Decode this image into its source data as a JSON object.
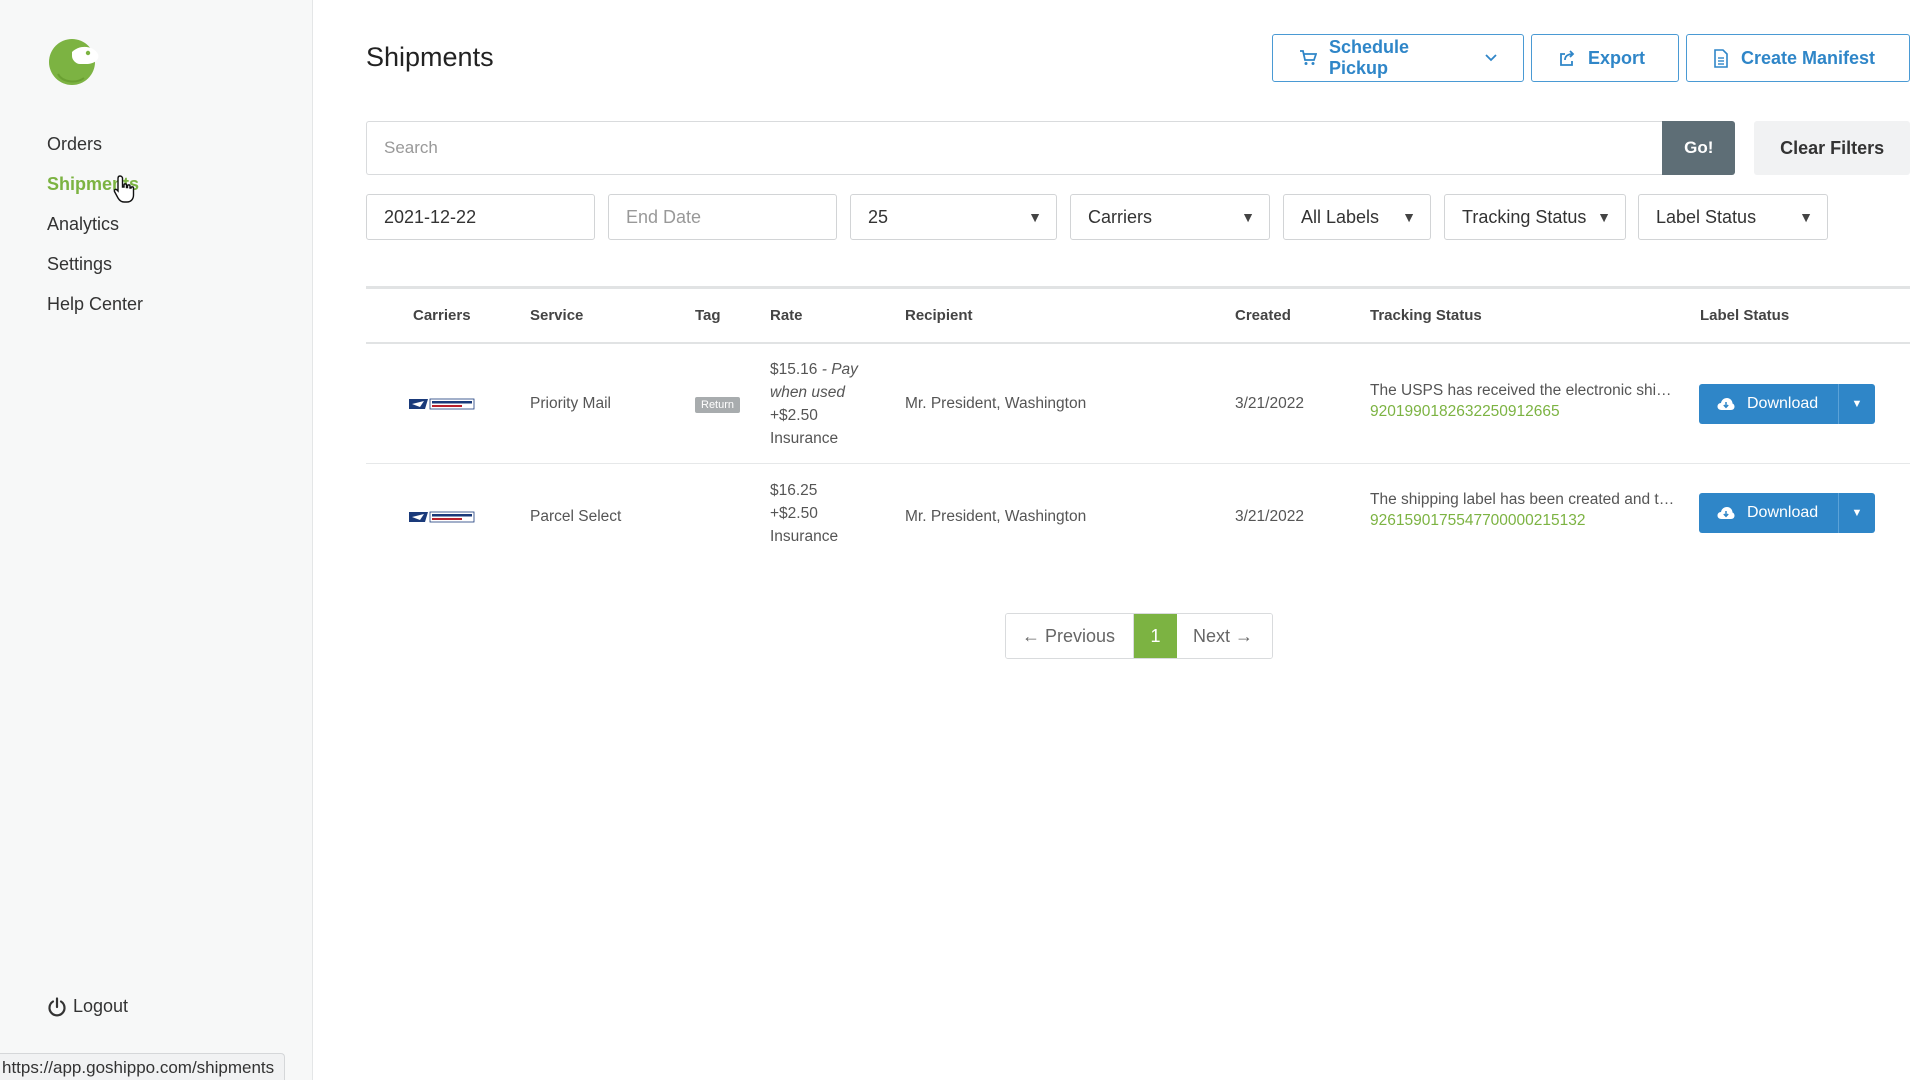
{
  "sidebar": {
    "nav": [
      {
        "label": "Orders"
      },
      {
        "label": "Shipments"
      },
      {
        "label": "Analytics"
      },
      {
        "label": "Settings"
      },
      {
        "label": "Help Center"
      }
    ],
    "logout_label": "Logout"
  },
  "status_bar": {
    "url": "https://app.goshippo.com/shipments"
  },
  "header": {
    "title": "Shipments",
    "schedule_pickup_label": "Schedule Pickup",
    "export_label": "Export",
    "create_manifest_label": "Create Manifest"
  },
  "search": {
    "placeholder": "Search",
    "go_label": "Go!",
    "clear_label": "Clear Filters"
  },
  "filters": {
    "start_date": "2021-12-22",
    "end_date_placeholder": "End Date",
    "per_page": "25",
    "carriers": "Carriers",
    "labels": "All Labels",
    "tracking_status": "Tracking Status",
    "label_status": "Label Status"
  },
  "table": {
    "headers": {
      "carriers": "Carriers",
      "service": "Service",
      "tag": "Tag",
      "rate": "Rate",
      "recipient": "Recipient",
      "created": "Created",
      "tracking_status": "Tracking Status",
      "label_status": "Label Status"
    },
    "rows": [
      {
        "carrier": "USPS",
        "service": "Priority Mail",
        "tag": "Return",
        "rate_amount": "$15.16",
        "rate_note": " - Pay when used",
        "rate_insurance": "+$2.50 Insurance",
        "recipient": "Mr. President, Washington",
        "created": "3/21/2022",
        "tracking_text": "The USPS has received the electronic shipment information",
        "tracking_number": "9201990182632250912665",
        "download_label": "Download"
      },
      {
        "carrier": "USPS",
        "service": "Parcel Select",
        "tag": "",
        "rate_amount": "$16.25",
        "rate_note": "",
        "rate_insurance": "+$2.50 Insurance",
        "recipient": "Mr. President, Washington",
        "created": "3/21/2022",
        "tracking_text": "The shipping label has been created and the package is awaiting pickup",
        "tracking_number": "9261590175547700000215132",
        "download_label": "Download"
      }
    ]
  },
  "pagination": {
    "prev_label": "← Previous",
    "current_page": "1",
    "next_label": "Next →"
  },
  "colors": {
    "accent_green": "#7cb342",
    "primary_blue": "#2f86c8",
    "go_button": "#5e6e76"
  }
}
